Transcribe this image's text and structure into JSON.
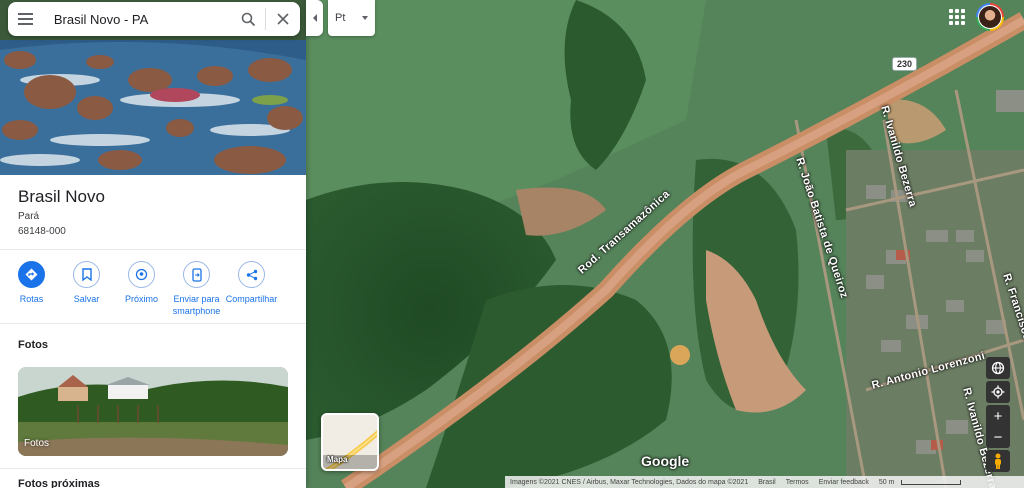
{
  "search": {
    "value": "Brasil Novo - PA",
    "placeholder": ""
  },
  "place": {
    "name": "Brasil Novo",
    "region": "Pará",
    "postal_code": "68148-000"
  },
  "actions": [
    {
      "label": "Rotas",
      "icon": "directions-icon"
    },
    {
      "label": "Salvar",
      "icon": "bookmark-icon"
    },
    {
      "label": "Próximo",
      "icon": "nearby-icon"
    },
    {
      "label": "Enviar para smartphone",
      "icon": "send-to-phone-icon"
    },
    {
      "label": "Compartilhar",
      "icon": "share-icon"
    }
  ],
  "photos": {
    "section_title": "Fotos",
    "card_label": "Fotos"
  },
  "panel_bottom_text": "Fotos próximas",
  "map": {
    "language_select": "Pt",
    "roads": {
      "highway_shield": "230",
      "labels": [
        "Rod. Transamazônica",
        "R. João Batista de Queiroz",
        "R. Ivanildo Bezerra",
        "R. Antonio Lorenzoni",
        "R. Ivanildo Bezerra",
        "R. Francisco"
      ]
    },
    "layer_button_label": "Mapa",
    "logo": "Google",
    "footer": {
      "imagery": "Imagens ©2021 CNES / Airbus, Maxar Technologies, Dados do mapa ©2021",
      "country": "Brasil",
      "terms": "Termos",
      "feedback": "Enviar feedback",
      "scale": "50 m"
    }
  },
  "colors": {
    "accent": "#1a73e8",
    "road": "#c98e66",
    "vegetation": "#3f6b3f"
  }
}
